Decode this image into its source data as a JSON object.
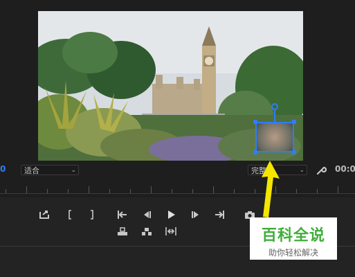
{
  "program_monitor": {
    "timecode_left": "0",
    "zoom_select": {
      "value": "适合"
    },
    "quality_select": {
      "value": "完整"
    },
    "timecode_right": "00:0"
  },
  "transport": {
    "icons": [
      "export-frame-icon",
      "mark-in-icon",
      "mark-out-icon",
      "go-to-in-icon",
      "step-back-icon",
      "play-icon",
      "step-forward-icon",
      "go-to-out-icon",
      "camera-icon",
      "lift-icon",
      "extract-icon",
      "compare-icon"
    ]
  },
  "watermark": {
    "title": "百科全说",
    "subtitle": "助你轻松解决"
  },
  "colors": {
    "accent": "#2f7df6",
    "annotation_arrow": "#f5e600",
    "watermark_green": "#3fae3a"
  }
}
